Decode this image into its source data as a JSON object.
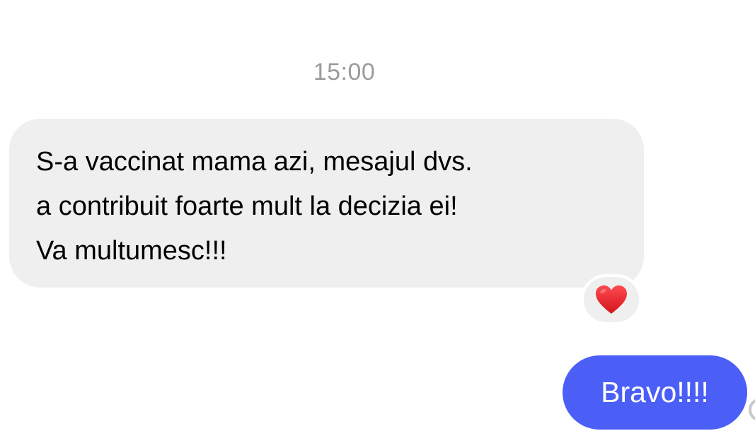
{
  "chat": {
    "timestamp": "15:00",
    "incoming_message": {
      "lines": [
        "S-a vaccinat mama azi, mesajul dvs.",
        "a contribuit foarte mult la decizia ei!",
        "Va multumesc!!!"
      ],
      "reaction": {
        "icon": "red-heart-icon",
        "color": "#e0242e"
      }
    },
    "outgoing_message": {
      "text": "Bravo!!!!"
    }
  },
  "colors": {
    "incoming_bubble": "#efefef",
    "outgoing_bubble": "#4b5ff7",
    "timestamp_text": "#9b9b9b"
  }
}
